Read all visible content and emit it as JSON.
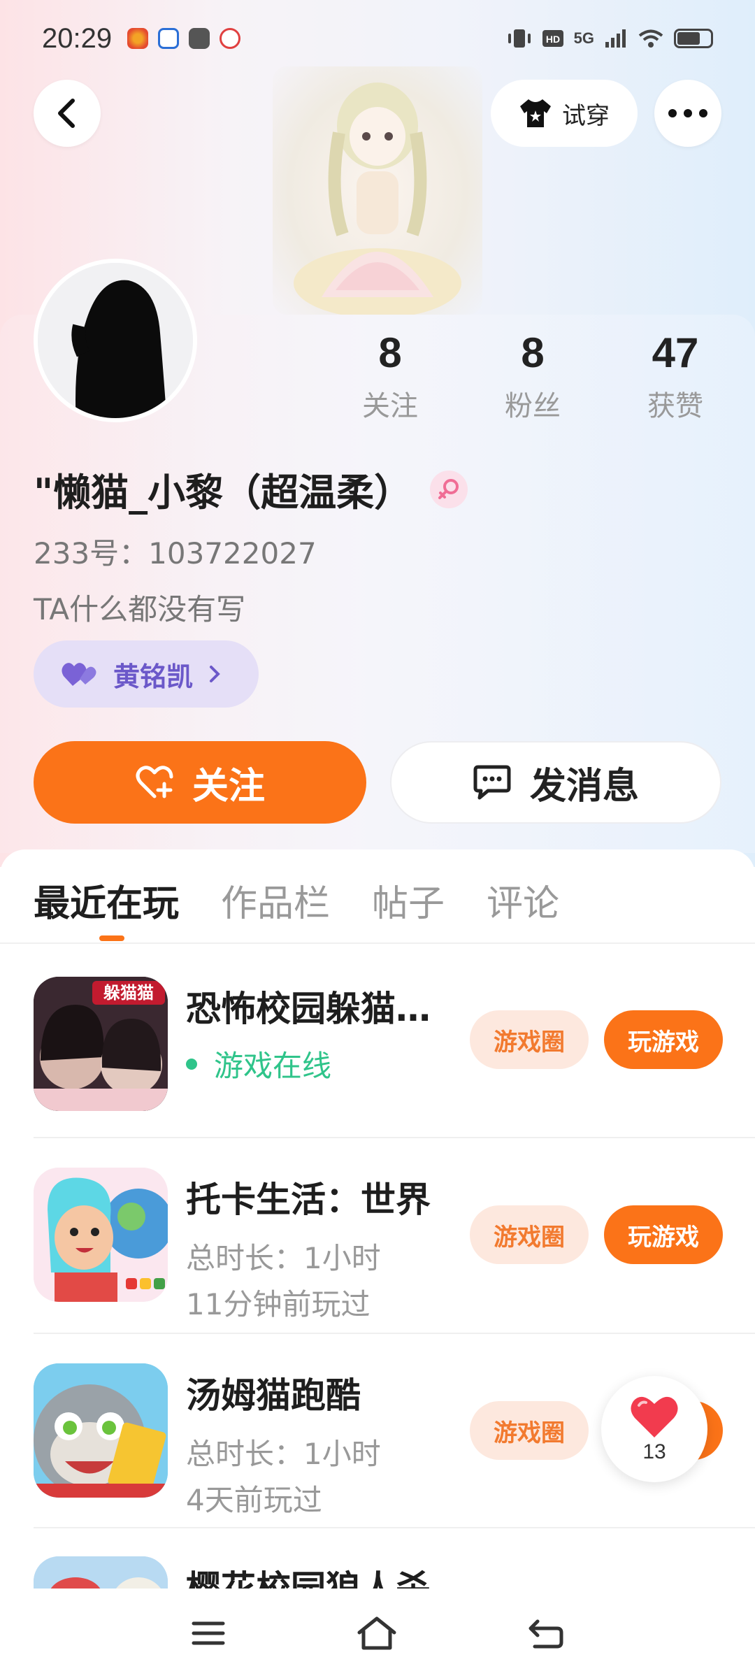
{
  "status_bar": {
    "time": "20:29",
    "network": "5G"
  },
  "header": {
    "try_on_label": "试穿"
  },
  "profile": {
    "stats": [
      {
        "value": "8",
        "label": "关注"
      },
      {
        "value": "8",
        "label": "粉丝"
      },
      {
        "value": "47",
        "label": "获赞"
      }
    ],
    "username": "\"懒猫_小黎（超温柔）",
    "uid": "233号：103722027",
    "bio": "TA什么都没有写",
    "tag_name": "黄铭凯",
    "follow_label": "关注",
    "message_label": "发消息"
  },
  "tabs": [
    {
      "label": "最近在玩",
      "active": true
    },
    {
      "label": "作品栏",
      "active": false
    },
    {
      "label": "帖子",
      "active": false
    },
    {
      "label": "评论",
      "active": false
    }
  ],
  "games": [
    {
      "title": "恐怖校园躲猫…",
      "status": "游戏在线",
      "circle_label": "游戏圈",
      "play_label": "玩游戏",
      "icon_text": "躲猫猫"
    },
    {
      "title": "托卡生活：世界",
      "duration": "总时长：1小时",
      "last_played": "11分钟前玩过",
      "circle_label": "游戏圈",
      "play_label": "玩游戏"
    },
    {
      "title": "汤姆猫跑酷",
      "duration": "总时长：1小时",
      "last_played": "4天前玩过",
      "circle_label": "游戏圈",
      "play_label": "玩游戏"
    },
    {
      "title": "樱花校园狼人杀"
    }
  ],
  "floating_like": {
    "count": "13"
  },
  "colors": {
    "accent": "#fb7318",
    "online": "#2fc48a",
    "tag_bg": "#e5dff7",
    "tag_text": "#6b58c9"
  }
}
